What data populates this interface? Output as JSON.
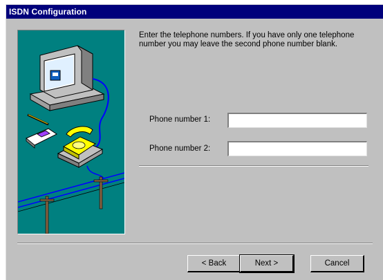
{
  "window": {
    "title": "ISDN Configuration"
  },
  "instructions": "Enter the telephone numbers.  If you have only one telephone number you may leave the second phone number blank.",
  "fields": [
    {
      "label": "Phone number 1:",
      "value": ""
    },
    {
      "label": "Phone number 2:",
      "value": ""
    }
  ],
  "buttons": {
    "back": "< Back",
    "next": "Next >",
    "cancel": "Cancel"
  },
  "colors": {
    "titlebar": "#00007b",
    "dialog": "#c0c0c0",
    "illustration_bg": "#008080"
  },
  "illustration_icons": [
    "computer-icon",
    "telephone-icon",
    "isdn-card-icon",
    "pen-icon",
    "utility-pole-icon"
  ]
}
